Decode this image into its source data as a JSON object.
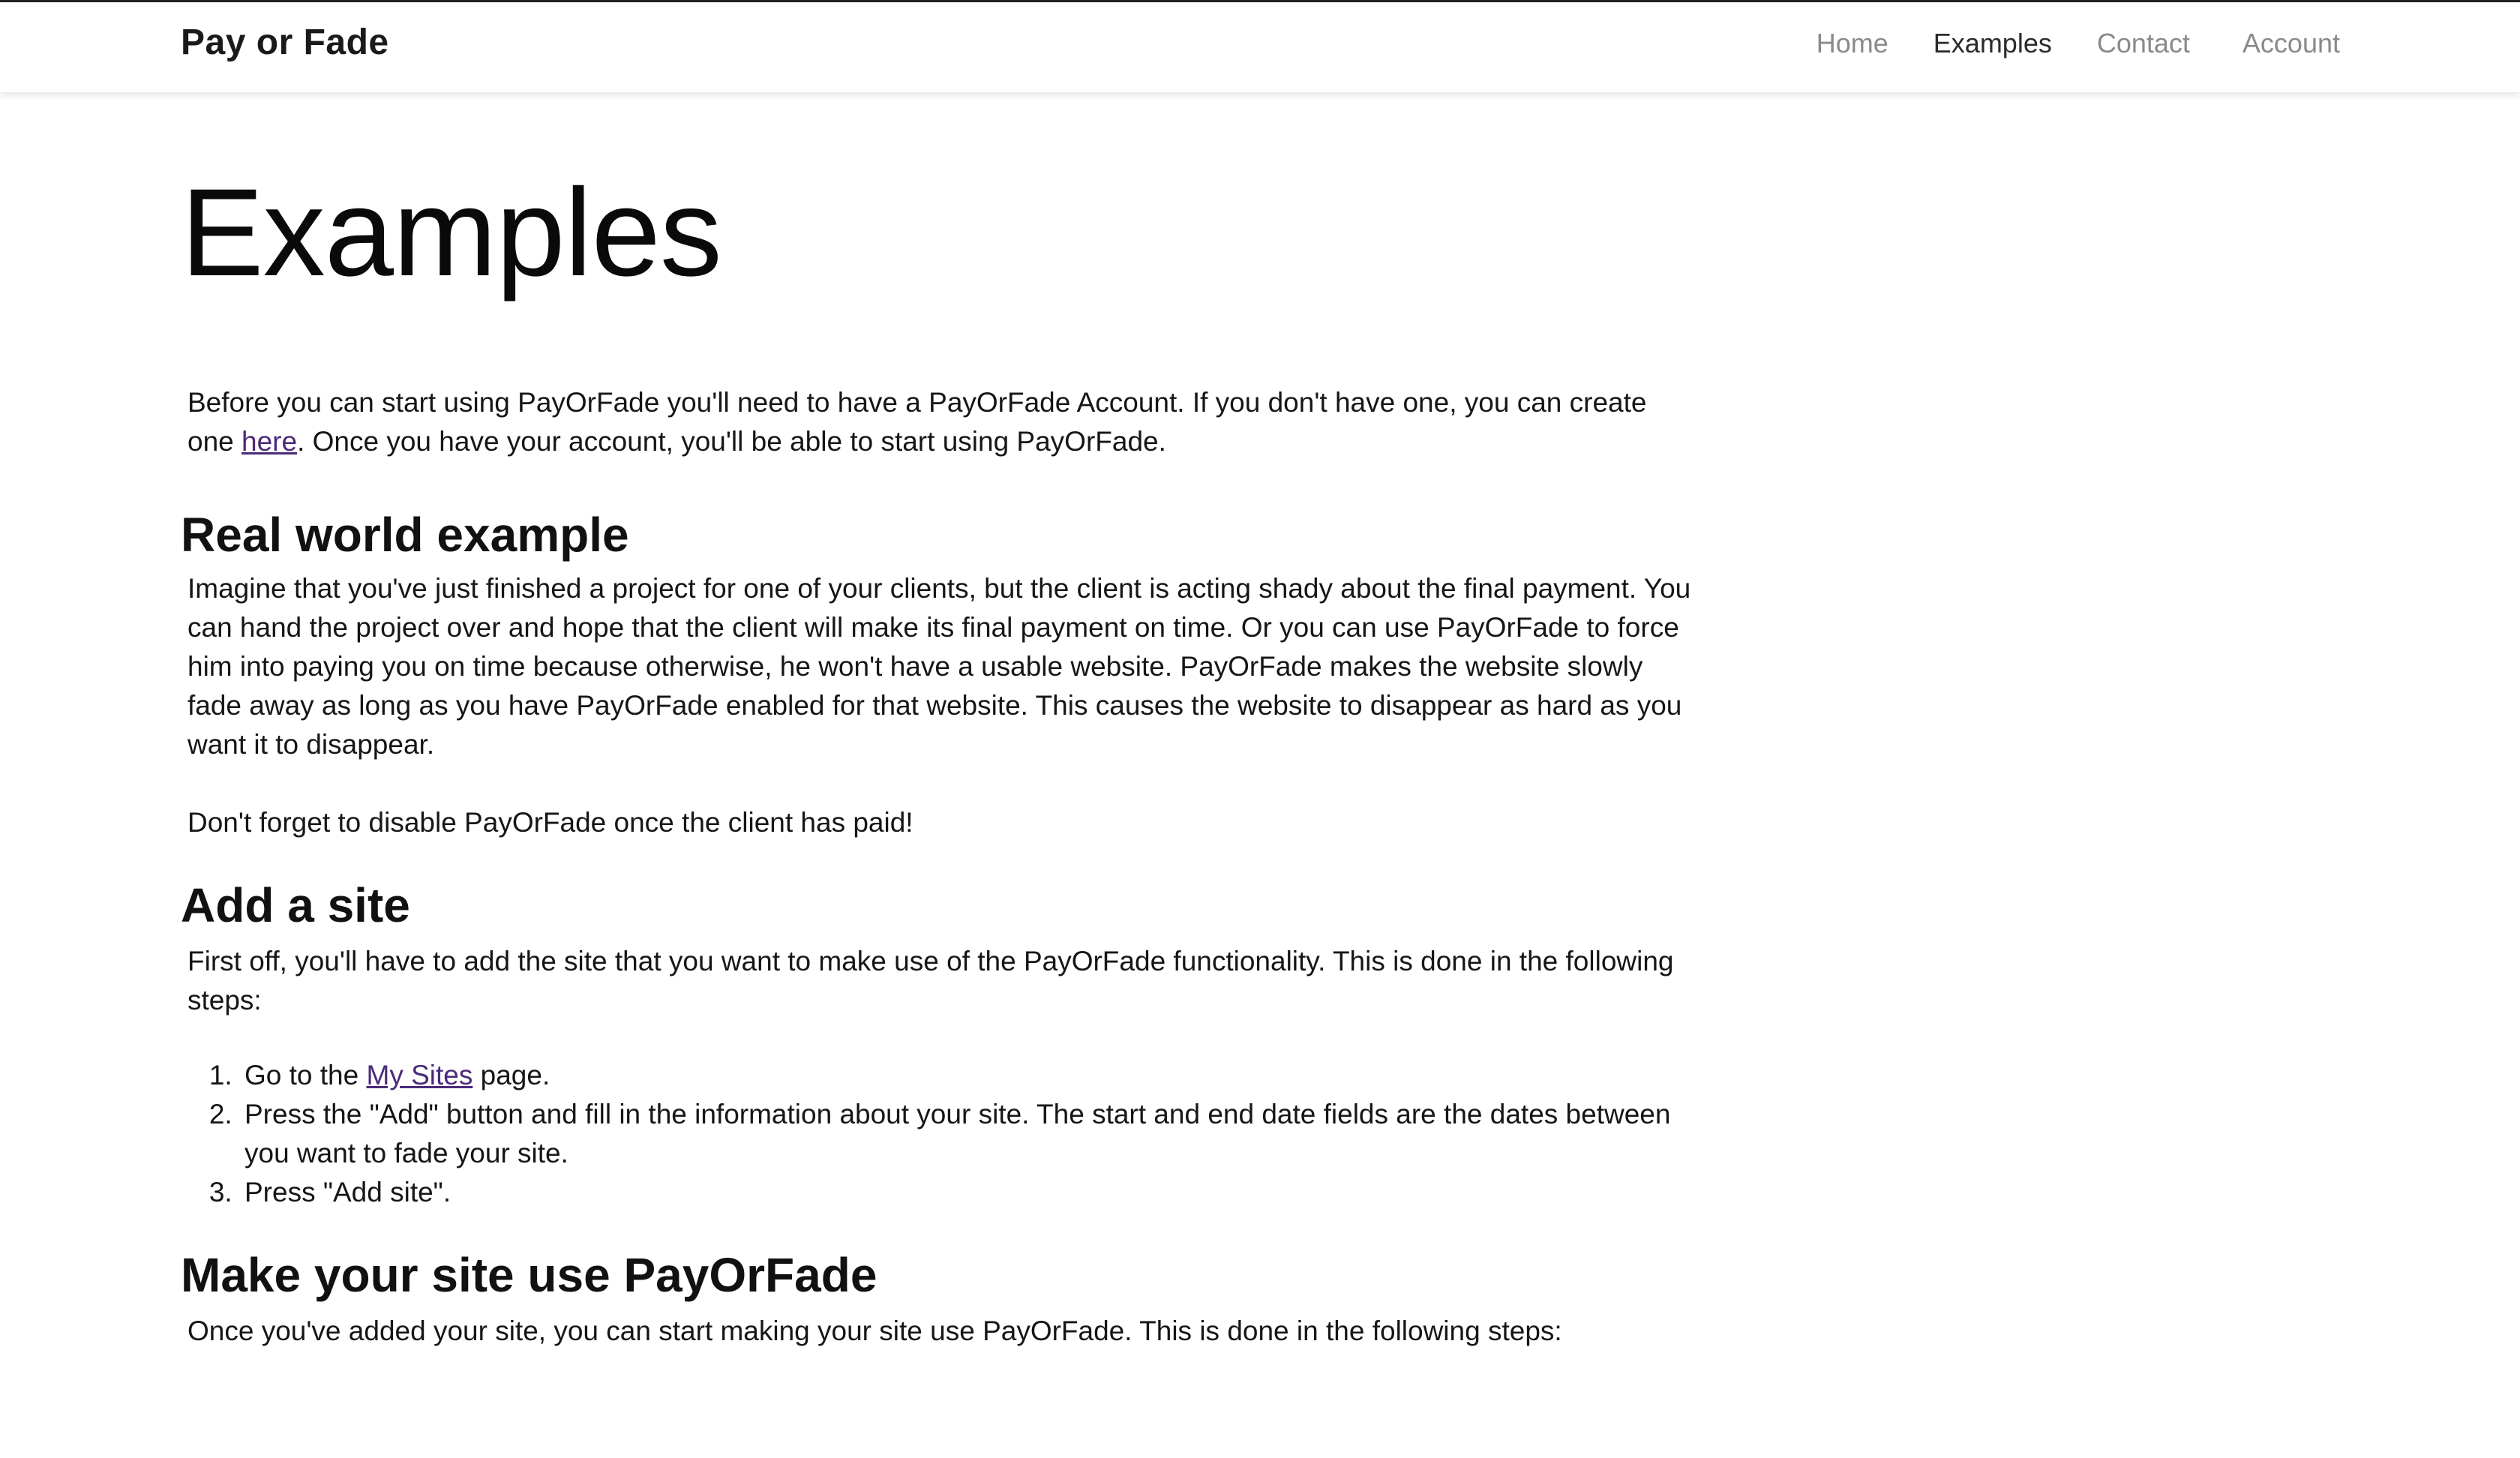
{
  "brand": "Pay or Fade",
  "nav": {
    "home": "Home",
    "examples": "Examples",
    "contact": "Contact",
    "account": "Account"
  },
  "page_title": "Examples",
  "intro": {
    "part1": "Before you can start using PayOrFade you'll need to have a PayOrFade Account. If you don't have one, you can create one ",
    "link": "here",
    "part2": ". Once you have your account, you'll be able to start using PayOrFade."
  },
  "real_world": {
    "title": "Real world example",
    "paragraph1": "Imagine that you've just finished a project for one of your clients, but the client is acting shady about the final payment. You can hand the project over and hope that the client will make its final payment on time. Or you can use PayOrFade to force him into paying you on time because otherwise, he won't have a usable website. PayOrFade makes the website slowly fade away as long as you have PayOrFade enabled for that website. This causes the website to disappear as hard as you want it to disappear.",
    "paragraph2": "Don't forget to disable PayOrFade once the client has paid!"
  },
  "add_site": {
    "title": "Add a site",
    "intro": "First off, you'll have to add the site that you want to make use of the PayOrFade functionality. This is done in the following steps:",
    "step1_prefix": "Go to the ",
    "step1_link": "My Sites",
    "step1_suffix": " page.",
    "step2": "Press the \"Add\" button and fill in the information about your site. The start and end date fields are the dates between you want to fade your site.",
    "step3": "Press \"Add site\"."
  },
  "make_site": {
    "title": "Make your site use PayOrFade",
    "intro": "Once you've added your site, you can start making your site use PayOrFade. This is done in the following steps:"
  }
}
